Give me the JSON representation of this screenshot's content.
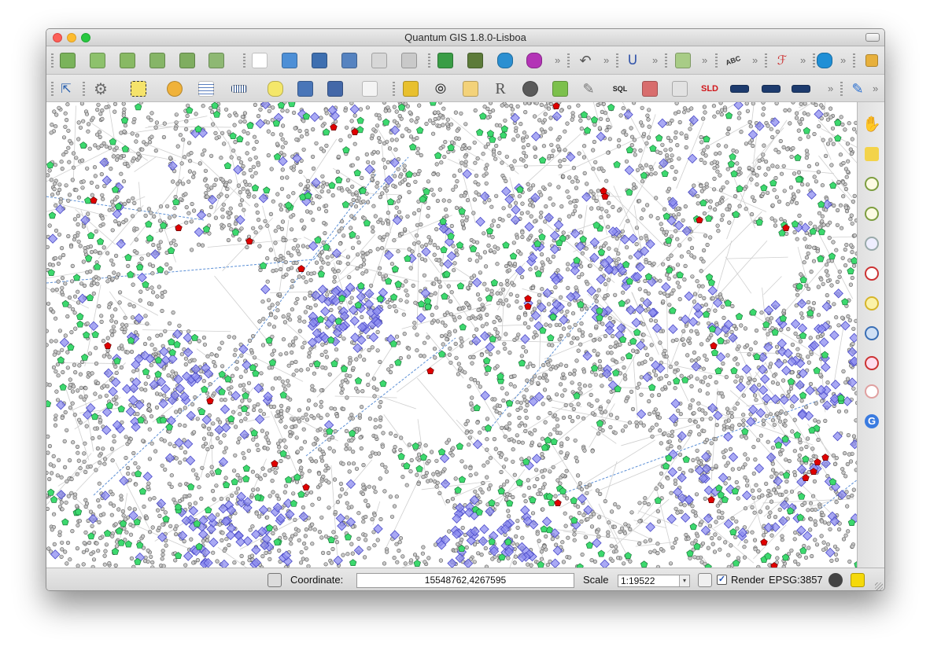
{
  "window": {
    "title": "Quantum GIS 1.8.0-Lisboa"
  },
  "toolbar1": {
    "icons": [
      "new-project-icon",
      "add-vector-icon",
      "add-raster-icon",
      "add-postgis-icon",
      "add-spatialite-icon",
      "add-wms-icon",
      "new-file-icon",
      "open-project-icon",
      "save-project-icon",
      "save-as-icon",
      "print-composer-icon",
      "print-icon",
      "add-feature-icon",
      "edit-icon",
      "database-add-icon",
      "database-icon",
      "undo-icon",
      "snapping-icon",
      "node-tool-icon",
      "label-icon",
      "digitize-icon",
      "plugin-icon",
      "image-icon"
    ]
  },
  "toolbar2": {
    "icons": [
      "identify-icon",
      "settings-gear-icon",
      "select-icon",
      "deselect-icon",
      "attribute-table-icon",
      "measure-icon",
      "annotation-icon",
      "hot-icon",
      "home-icon",
      "text-annotation-icon",
      "plugin-green-icon",
      "binoculars-icon",
      "calendar-icon",
      "r-icon",
      "globe-icon",
      "python-icon",
      "pen-icon",
      "sql-add-icon",
      "db-manager-icon",
      "sql-query-icon",
      "sld-icon",
      "raster-1-icon",
      "raster-2-icon",
      "raster-3-icon",
      "edit-pencil-icon"
    ],
    "sld_label": "SLD"
  },
  "sidebar": {
    "icons": [
      "pan-hand-icon",
      "pan-to-selection-icon",
      "zoom-in-icon",
      "zoom-out-icon",
      "zoom-actual-icon",
      "zoom-full-icon",
      "zoom-layer-icon",
      "zoom-selection-icon",
      "zoom-last-icon",
      "zoom-next-icon",
      "refresh-icon"
    ]
  },
  "statusbar": {
    "coordinate_label": "Coordinate:",
    "coordinate_value": "15548762,4267595",
    "scale_label": "Scale",
    "scale_value": "1:19522",
    "render_label": "Render",
    "render_checked": true,
    "crs_label": "EPSG:3857"
  },
  "map_layers": {
    "points_color": "#8a8a8a",
    "green_features_color": "#3cd96e",
    "red_features_color": "#e00000",
    "blue_features_color": "#8c8cf0",
    "lines_color": "#cfcfcf",
    "blue_lines_color": "#5b8fd6"
  }
}
